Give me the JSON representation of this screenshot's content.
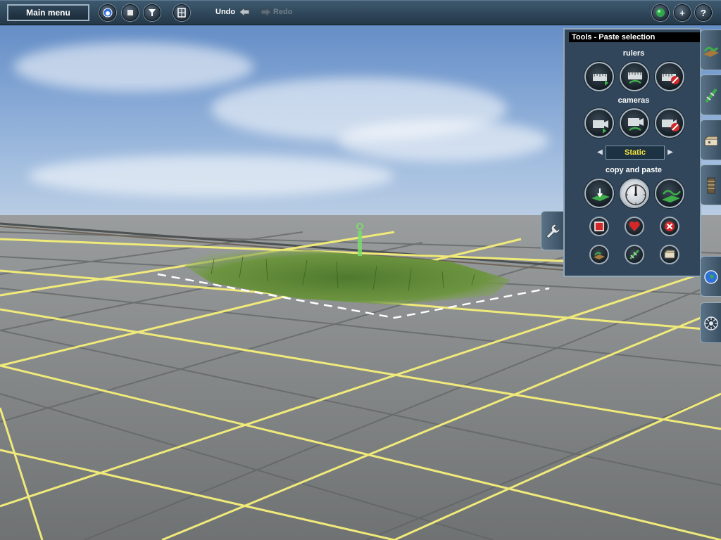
{
  "toolbar": {
    "main_menu": "Main menu",
    "undo": "Undo",
    "redo": "Redo",
    "help_glyph": "?",
    "add_glyph": "+",
    "icons": [
      "view-mode-icon",
      "stop-icon",
      "filter-icon",
      "grid-icon",
      "gem-icon",
      "add-icon",
      "help-icon"
    ]
  },
  "tools_panel": {
    "title": "Tools - Paste selection",
    "sections": {
      "rulers": "rulers",
      "cameras": "cameras",
      "copy_paste": "copy and paste"
    },
    "mode": {
      "value": "Static",
      "prev_glyph": "◀",
      "next_glyph": "▶"
    }
  },
  "side_tabs": [
    "terrain-tab-icon",
    "track-tab-icon",
    "objects-tab-icon",
    "rail-tab-icon",
    "globe-tab-icon",
    "settings-tab-icon"
  ],
  "colors": {
    "grid_line": "#f0ea7a",
    "ground": "#7b7e7f",
    "panel": "#31465a",
    "accent_yellow": "#f3e23c"
  }
}
